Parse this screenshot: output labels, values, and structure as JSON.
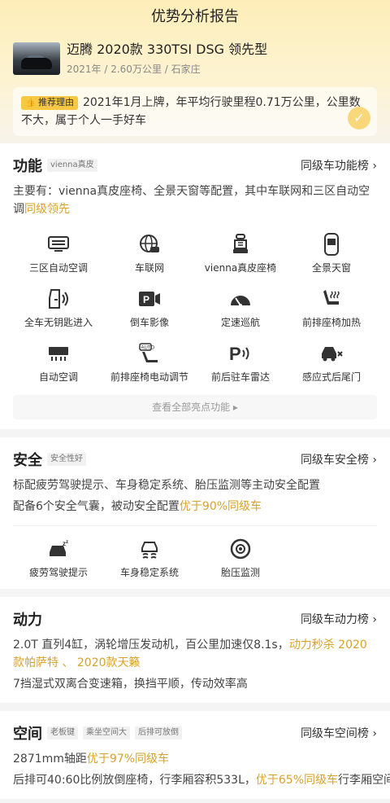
{
  "header": {
    "title": "优势分析报告"
  },
  "car": {
    "name": "迈腾 2020款 330TSI DSG 领先型",
    "year": "2021年",
    "mileage": "2.60万公里",
    "city": "石家庄",
    "sep": " / "
  },
  "recommend": {
    "badge": "推荐理由",
    "text": "2021年1月上牌，年平均行驶里程0.71万公里，公里数不大，属于个人一手好车"
  },
  "function": {
    "title": "功能",
    "tag": "vienna真皮",
    "rank_link": "同级车功能榜 ›",
    "desc_prefix": "主要有：vienna真皮座椅、全景天窗等配置，其中车联网和三区自动空调",
    "desc_highlight": "同级领先",
    "items": [
      {
        "label": "三区自动空调",
        "icon": "ac-panel-icon"
      },
      {
        "label": "车联网",
        "icon": "globe-car-icon"
      },
      {
        "label": "vienna真皮座椅",
        "icon": "seat-icon"
      },
      {
        "label": "全景天窗",
        "icon": "sunroof-icon"
      },
      {
        "label": "全车无钥匙进入",
        "icon": "keyless-door-icon"
      },
      {
        "label": "倒车影像",
        "icon": "reverse-camera-icon"
      },
      {
        "label": "定速巡航",
        "icon": "cruise-gauge-icon"
      },
      {
        "label": "前排座椅加热",
        "icon": "seat-heat-icon"
      },
      {
        "label": "自动空调",
        "icon": "auto-ac-icon"
      },
      {
        "label": "前排座椅电动调节",
        "icon": "power-seat-icon"
      },
      {
        "label": "前后驻车雷达",
        "icon": "parking-radar-icon"
      },
      {
        "label": "感应式后尾门",
        "icon": "tailgate-icon"
      }
    ],
    "view_all": "查看全部亮点功能 ▸"
  },
  "safety": {
    "title": "安全",
    "tag": "安全性好",
    "rank_link": "同级车安全榜 ›",
    "line1": "标配疲劳驾驶提示、车身稳定系统、胎压监测等主动安全配置",
    "line2_prefix": "配备6个安全气囊，被动安全配置",
    "line2_highlight": "优于90%同级车",
    "items": [
      {
        "label": "疲劳驾驶提示",
        "icon": "fatigue-icon"
      },
      {
        "label": "车身稳定系统",
        "icon": "stability-icon"
      },
      {
        "label": "胎压监测",
        "icon": "tire-pressure-icon"
      }
    ]
  },
  "power": {
    "title": "动力",
    "rank_link": "同级车动力榜 ›",
    "line1_prefix": "2.0T 直列4缸，涡轮增压发动机，百公里加速仅8.1s，",
    "line1_highlight": "动力秒杀 2020款帕萨特 、 2020款天籁",
    "line1_suffix": "",
    "line2": "7挡湿式双离合变速箱，换挡平顺，传动效率高"
  },
  "space": {
    "title": "空间",
    "tags": [
      "老板键",
      "乘坐空间大",
      "后排可放倒"
    ],
    "rank_link": "同级车空间榜 ›",
    "line1_prefix": "2871mm轴距",
    "line1_highlight": "优于97%同级车",
    "line2_prefix": "后排可40:60比例放倒座椅，行李厢容积533L，",
    "line2_highlight": "优于65%同级车",
    "line2_suffix": "行李厢空间"
  }
}
